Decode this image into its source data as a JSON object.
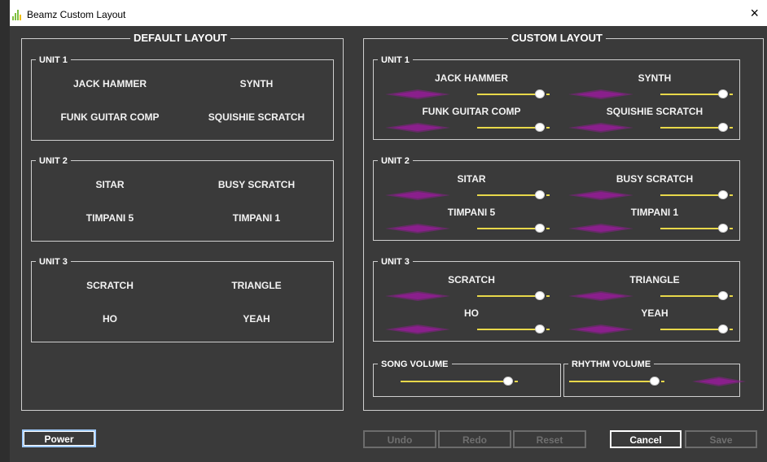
{
  "window": {
    "title": "Beamz Custom Layout",
    "close_glyph": "×",
    "icon": "beamz-bars-icon"
  },
  "default_layout": {
    "legend": "DEFAULT LAYOUT",
    "units": [
      {
        "legend": "UNIT 1",
        "items": [
          "JACK HAMMER",
          "SYNTH",
          "FUNK GUITAR COMP",
          "SQUISHIE SCRATCH"
        ]
      },
      {
        "legend": "UNIT 2",
        "items": [
          "SITAR",
          "BUSY SCRATCH",
          "TIMPANI 5",
          "TIMPANI 1"
        ]
      },
      {
        "legend": "UNIT 3",
        "items": [
          "SCRATCH",
          "TRIANGLE",
          "HO",
          "YEAH"
        ]
      }
    ]
  },
  "custom_layout": {
    "legend": "CUSTOM LAYOUT",
    "units": [
      {
        "legend": "UNIT 1",
        "items": [
          "JACK HAMMER",
          "SYNTH",
          "FUNK GUITAR COMP",
          "SQUISHIE SCRATCH"
        ]
      },
      {
        "legend": "UNIT 2",
        "items": [
          "SITAR",
          "BUSY SCRATCH",
          "TIMPANI 5",
          "TIMPANI 1"
        ]
      },
      {
        "legend": "UNIT 3",
        "items": [
          "SCRATCH",
          "TRIANGLE",
          "HO",
          "YEAH"
        ]
      }
    ],
    "slider_level": 0.85,
    "song_volume": {
      "legend": "SONG VOLUME",
      "level": 0.86
    },
    "rhythm_volume": {
      "legend": "RHYTHM VOLUME",
      "level": 0.86
    }
  },
  "buttons": {
    "power": "Power",
    "undo": "Undo",
    "redo": "Redo",
    "reset": "Reset",
    "cancel": "Cancel",
    "save": "Save"
  },
  "colors": {
    "background": "#3a3a3a",
    "slider_track": "#e8d84a",
    "pad": "#8a1f8c",
    "border": "#cfcfcf",
    "disabled_text": "#6f6f6f"
  }
}
